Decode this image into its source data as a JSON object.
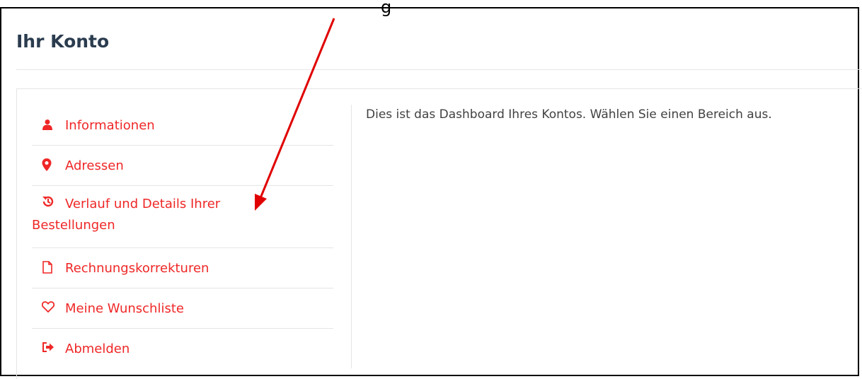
{
  "header": {
    "partial_top_text": "g"
  },
  "page": {
    "title": "Ihr Konto"
  },
  "nav": {
    "items": [
      {
        "label": "Informationen",
        "icon": "user-icon"
      },
      {
        "label": "Adressen",
        "icon": "map-marker-icon"
      },
      {
        "label_line1": "Verlauf und Details Ihrer",
        "label_line2": "Bestellungen",
        "icon": "history-icon"
      },
      {
        "label": "Rechnungskorrekturen",
        "icon": "file-icon"
      },
      {
        "label": "Meine Wunschliste",
        "icon": "heart-icon"
      },
      {
        "label": "Abmelden",
        "icon": "sign-out-icon"
      }
    ]
  },
  "main": {
    "text": "Dies ist das Dashboard Ihres Kontos. Wählen Sie einen Bereich aus."
  },
  "colors": {
    "accent": "#ef2727",
    "title": "#2b3c4f",
    "text": "#414141",
    "divider": "#e5e5e5",
    "annotation_arrow": "#e00000"
  }
}
